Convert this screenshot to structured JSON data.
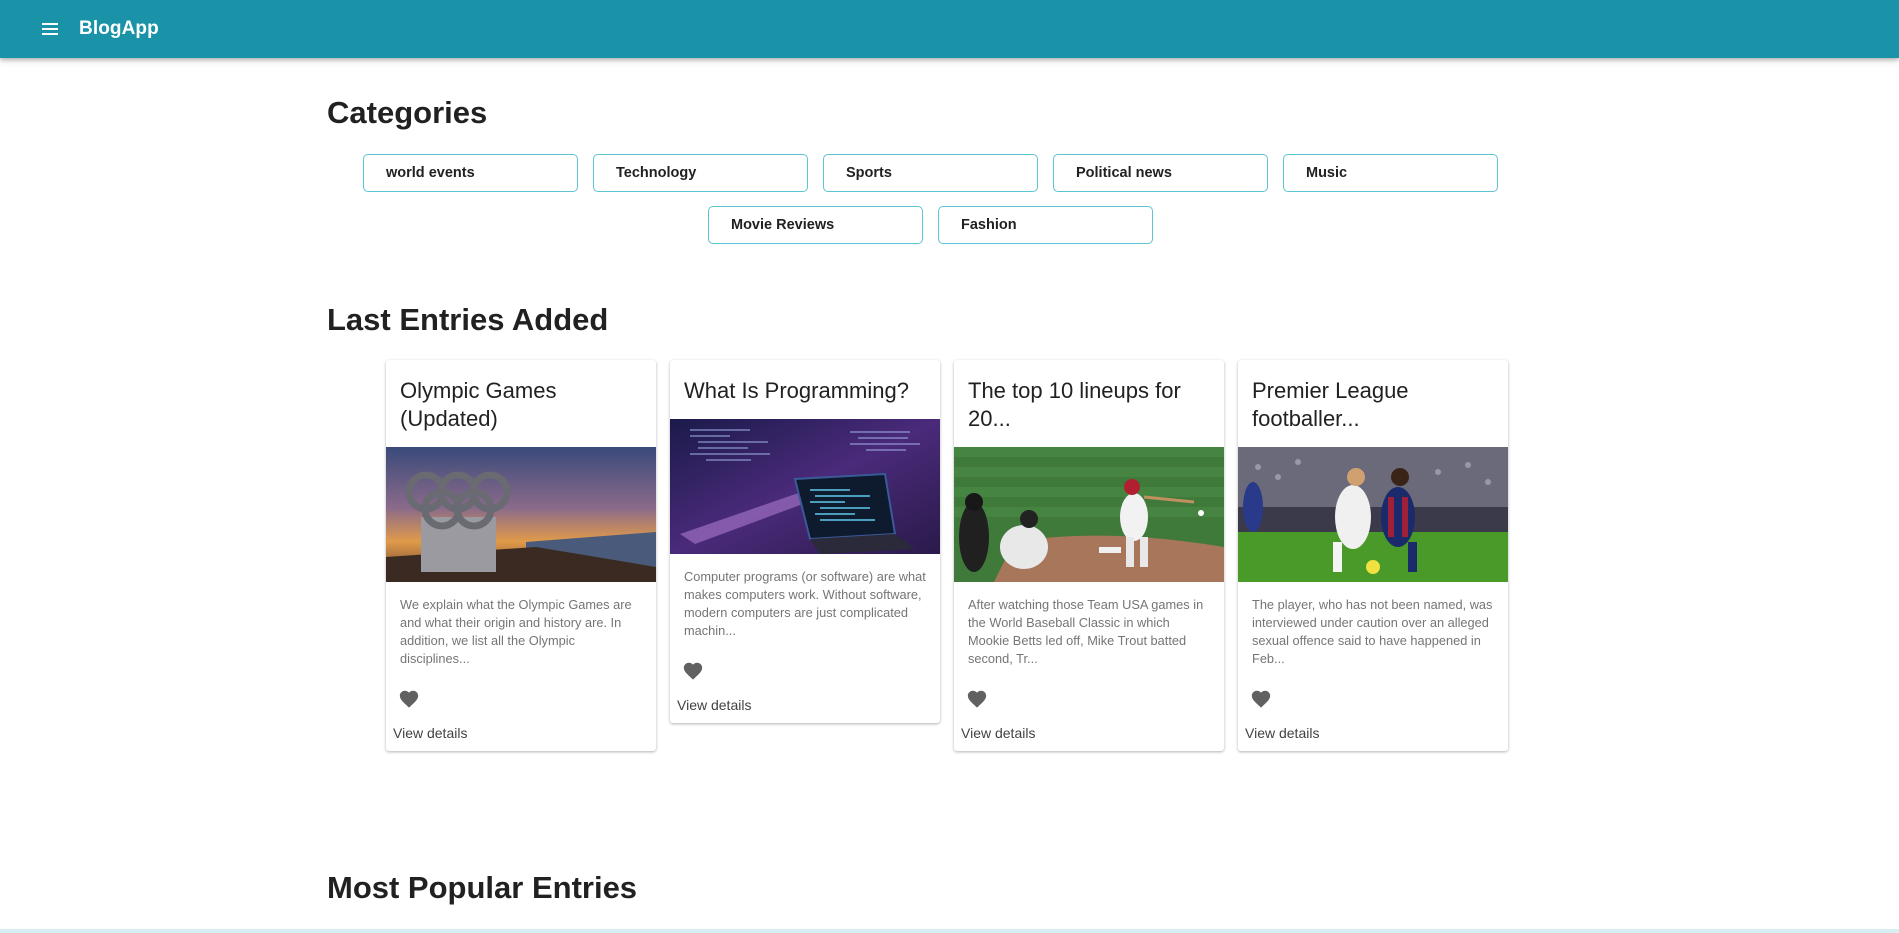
{
  "app": {
    "title": "BlogApp"
  },
  "icons": {
    "menu": "menu-icon",
    "favorite": "heart-icon"
  },
  "colors": {
    "primary": "#1a93a8",
    "chip_border": "#5cc4d2",
    "heart": "#616161"
  },
  "sections": {
    "categories": "Categories",
    "last_entries": "Last Entries Added",
    "most_popular": "Most Popular Entries"
  },
  "categories": {
    "row1": [
      "world events",
      "Technology",
      "Sports",
      "Political news",
      "Music"
    ],
    "row2": [
      "Movie Reviews",
      "Fashion"
    ]
  },
  "entries": [
    {
      "title": "Olympic Games (Updated)",
      "image": "olympic rings sculpture at sunset",
      "excerpt": "We explain what the Olympic Games are and what their origin and history are. In addition, we list all the Olympic disciplines...",
      "link": "View details"
    },
    {
      "title": "What Is Programming?",
      "image": "laptop with code on screen",
      "excerpt": "Computer programs (or software) are what makes computers work. Without software, modern computers are just complicated machin...",
      "link": "View details"
    },
    {
      "title": "The top 10 lineups for 20...",
      "image": "baseball batter swinging",
      "excerpt": "After watching those Team USA games in the World Baseball Classic in which Mookie Betts led off, Mike Trout batted second, Tr...",
      "link": "View details"
    },
    {
      "title": "Premier League footballer...",
      "image": "football players competing for ball",
      "excerpt": "The player, who has not been named, was interviewed under caution over an alleged sexual offence said to have happened in Feb...",
      "link": "View details"
    }
  ]
}
